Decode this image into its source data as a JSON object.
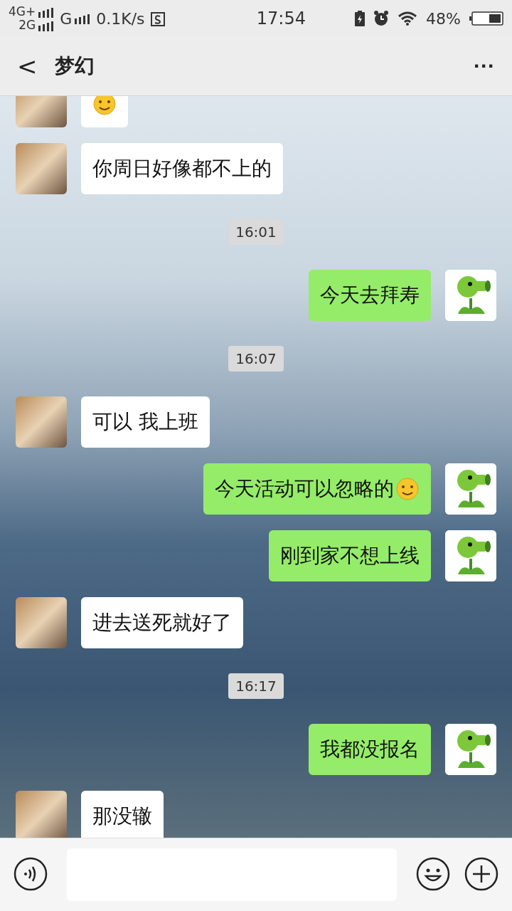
{
  "status_bar": {
    "network_1": "4G+",
    "network_2": "2G",
    "network_3": "G",
    "speed": "0.1K/s",
    "time": "17:54",
    "battery": "48%"
  },
  "header": {
    "back": "<",
    "title": "梦幻",
    "more": "···"
  },
  "messages": [
    {
      "kind": "incoming",
      "emoji": true
    },
    {
      "kind": "incoming",
      "text": "你周日好像都不上的",
      "emoji": false
    },
    {
      "kind": "time",
      "text": "16:01"
    },
    {
      "kind": "outgoing",
      "text": "今天去拜寿",
      "emoji": false
    },
    {
      "kind": "time",
      "text": "16:07"
    },
    {
      "kind": "incoming",
      "text": "可以  我上班",
      "emoji": false
    },
    {
      "kind": "outgoing",
      "text": "今天活动可以忽略的",
      "emoji": true
    },
    {
      "kind": "outgoing",
      "text": "刚到家不想上线",
      "emoji": false
    },
    {
      "kind": "incoming",
      "text": "进去送死就好了",
      "emoji": false
    },
    {
      "kind": "time",
      "text": "16:17"
    },
    {
      "kind": "outgoing",
      "text": "我都没报名",
      "emoji": false
    },
    {
      "kind": "incoming",
      "text": "那没辙",
      "emoji": false
    }
  ]
}
